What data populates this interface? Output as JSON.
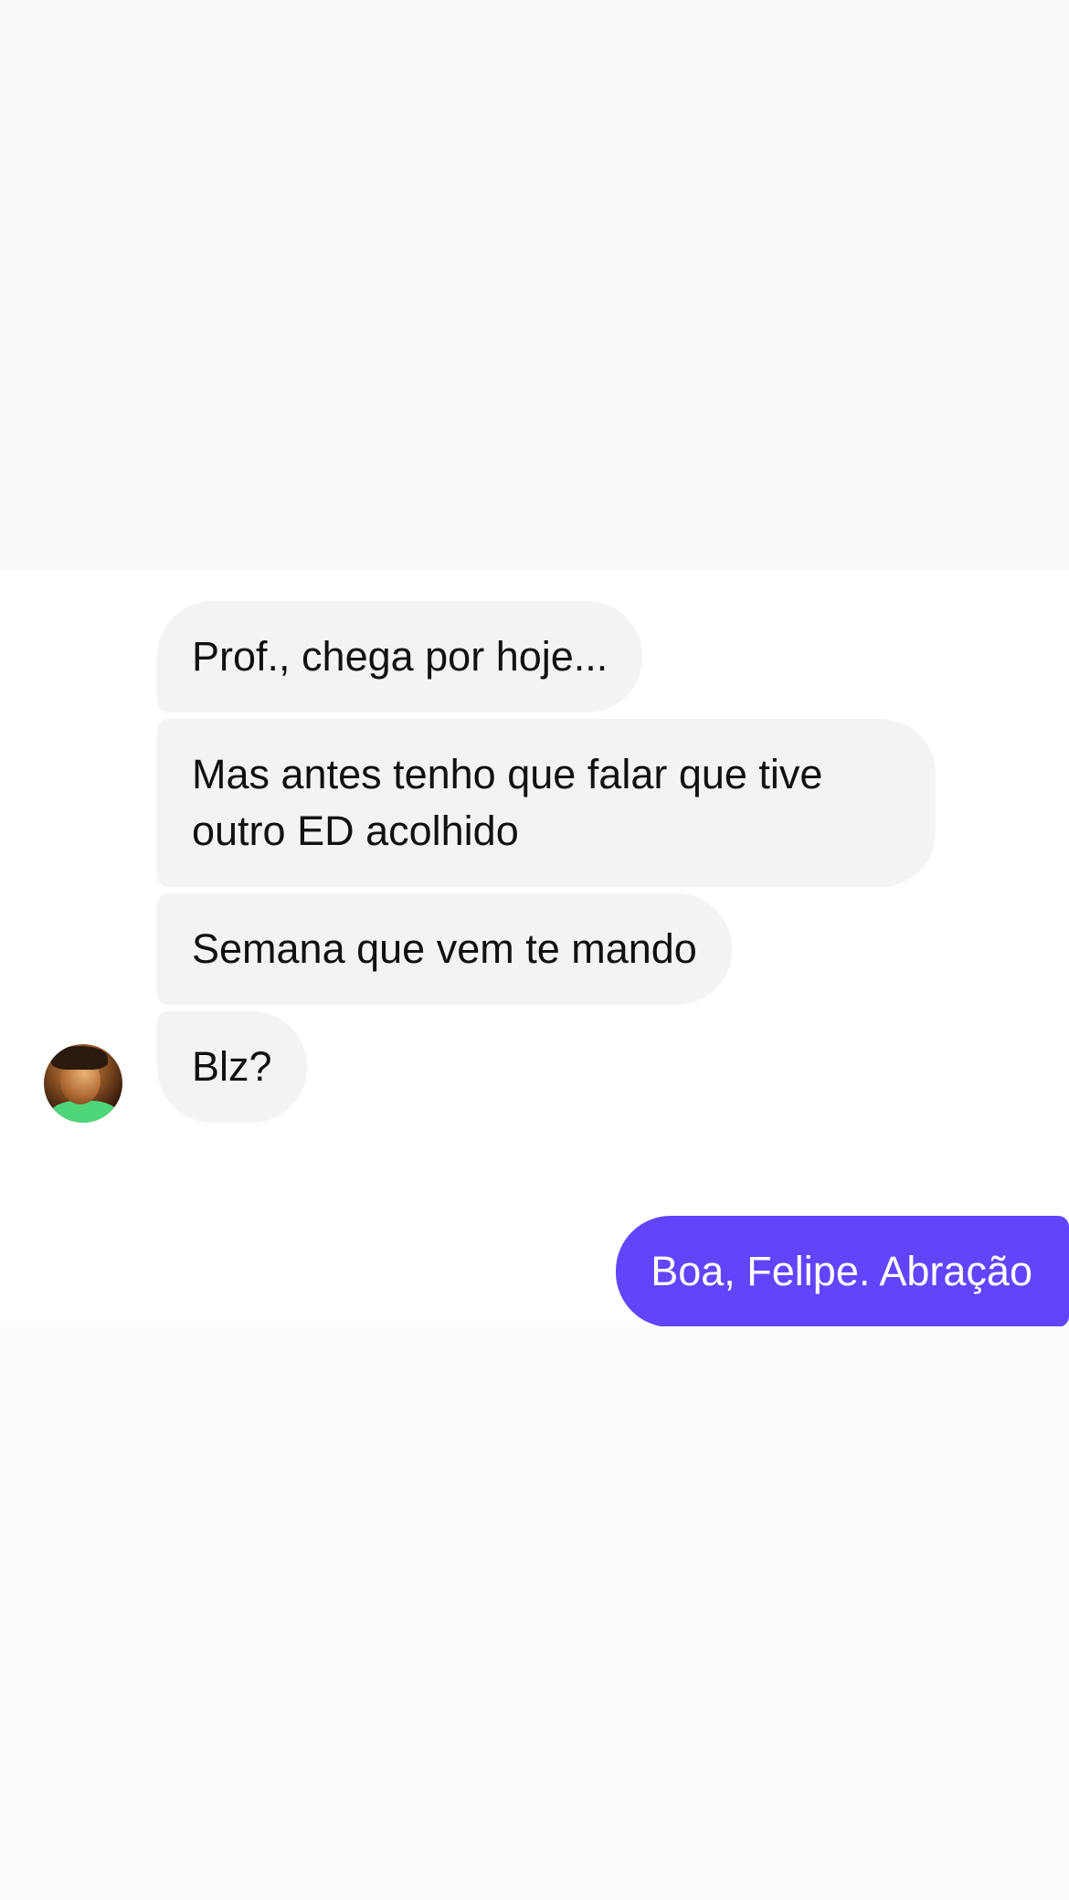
{
  "messages": {
    "incoming": [
      {
        "text": "Prof., chega por hoje..."
      },
      {
        "text": "Mas antes tenho que falar que tive outro ED acolhido"
      },
      {
        "text": "Semana que vem te mando"
      },
      {
        "text": "Blz?"
      }
    ],
    "outgoing": [
      {
        "text": "Boa, Felipe. Abração"
      }
    ]
  },
  "colors": {
    "incoming_bubble": "#f2f3f5",
    "outgoing_bubble": "#6244fa",
    "incoming_text": "#111111",
    "outgoing_text": "#ffffff"
  }
}
